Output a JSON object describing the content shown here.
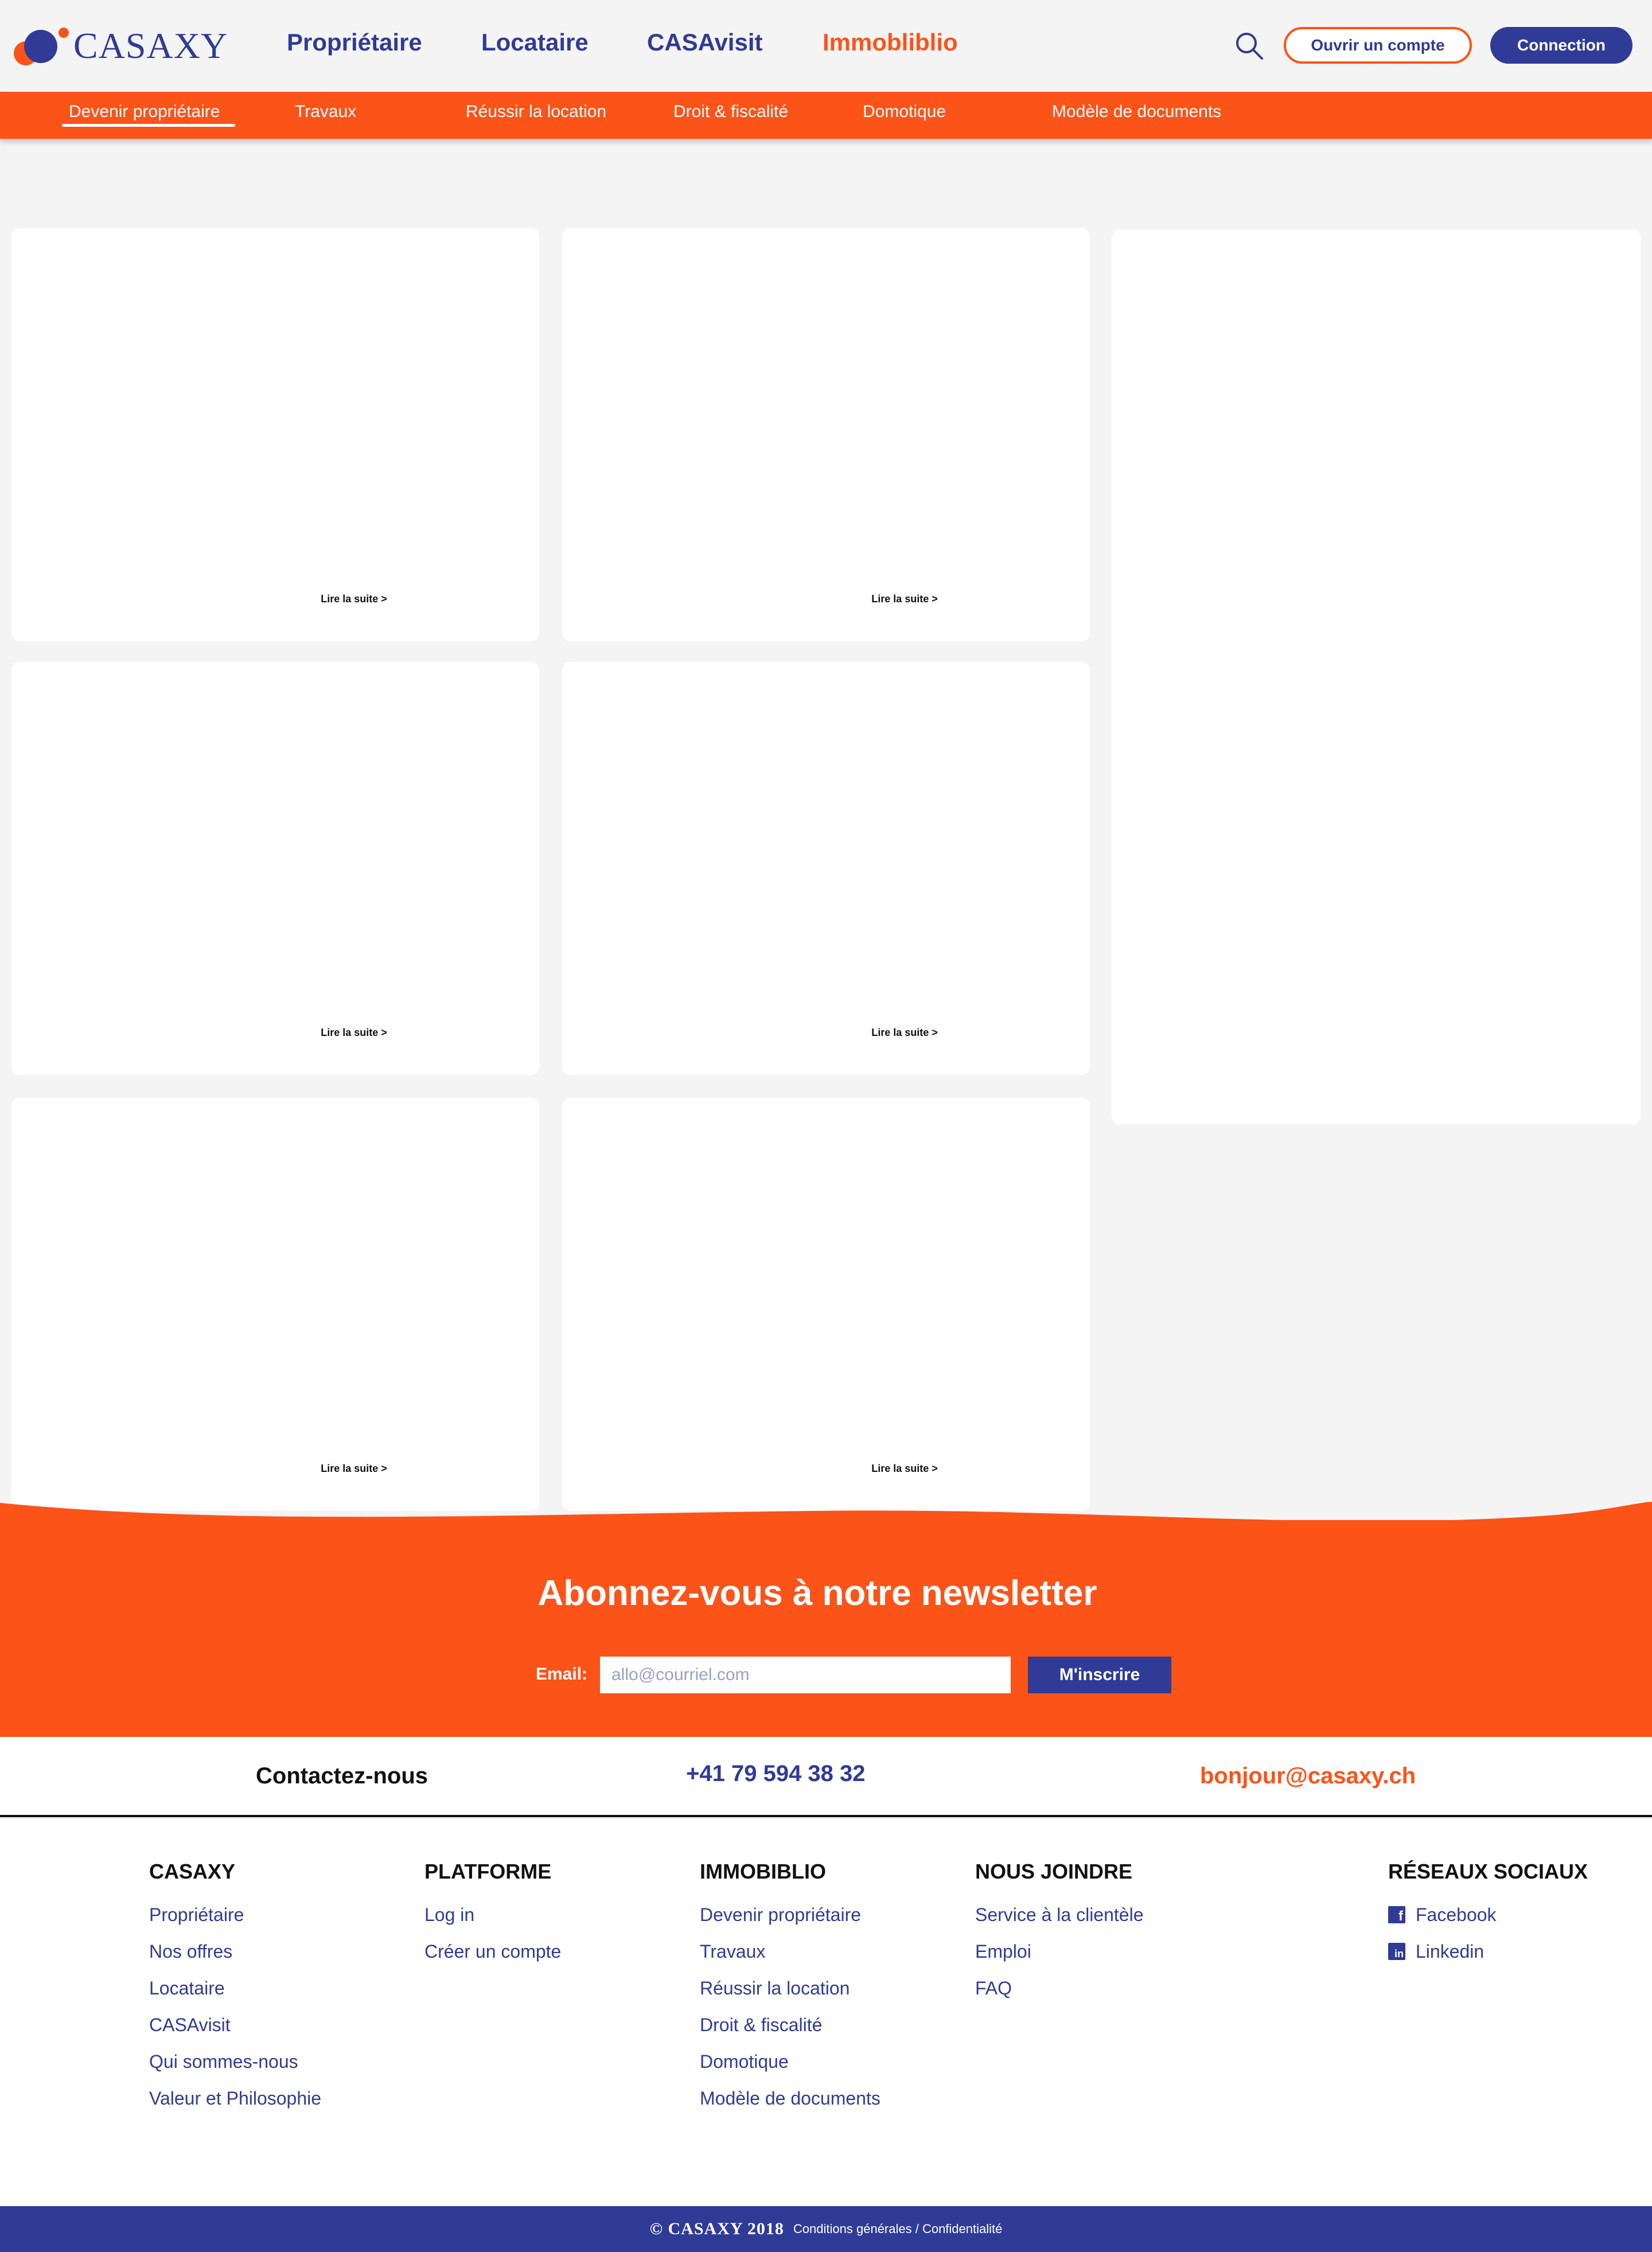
{
  "brand": {
    "name": "CASAXY",
    "primary_color": "#2f3b96",
    "accent_color": "#fc5319"
  },
  "header": {
    "nav": [
      "Propriétaire",
      "Locataire",
      "CASAvisit",
      "Immobliblio"
    ],
    "active_nav": "Immobliblio",
    "search_icon": "search-icon",
    "open_account_label": "Ouvrir un compte",
    "login_label": "Connection"
  },
  "subnav": {
    "items": [
      "Devenir propriétaire",
      "Travaux",
      "Réussir la location",
      "Droit & fiscalité",
      "Domotique",
      "Modèle de documents"
    ],
    "active": "Devenir propriétaire"
  },
  "articles": {
    "read_more_label": "Lire la suite >",
    "count": 6
  },
  "newsletter": {
    "title": "Abonnez-vous à notre newsletter",
    "email_label": "Email:",
    "email_placeholder": "allo@courriel.com",
    "submit_label": "M'inscrire"
  },
  "contact": {
    "label": "Contactez-nous",
    "phone": "+41 79 594 38 32",
    "email": "bonjour@casaxy.ch"
  },
  "footer": {
    "columns": [
      {
        "title": "CASAXY",
        "links": [
          "Propriétaire",
          "Nos offres",
          "Locataire",
          "CASAvisit",
          "Qui sommes-nous",
          "Valeur et Philosophie"
        ]
      },
      {
        "title": "PLATFORME",
        "links": [
          "Log in",
          "Créer un compte"
        ]
      },
      {
        "title": "IMMOBIBLIO",
        "links": [
          "Devenir propriétaire",
          "Travaux",
          "Réussir la location",
          "Droit & fiscalité",
          "Domotique",
          "Modèle de documents"
        ]
      },
      {
        "title": "NOUS JOINDRE",
        "links": [
          "Service à la clientèle",
          "Emploi",
          "FAQ"
        ]
      },
      {
        "title": "RÉSEAUX SOCIAUX",
        "links": [
          "Facebook",
          "Linkedin"
        ],
        "icons": [
          "facebook-icon",
          "linkedin-icon"
        ]
      }
    ],
    "copyright": "© CASAXY 2018",
    "legal": "Conditions générales / Confidentialité"
  }
}
